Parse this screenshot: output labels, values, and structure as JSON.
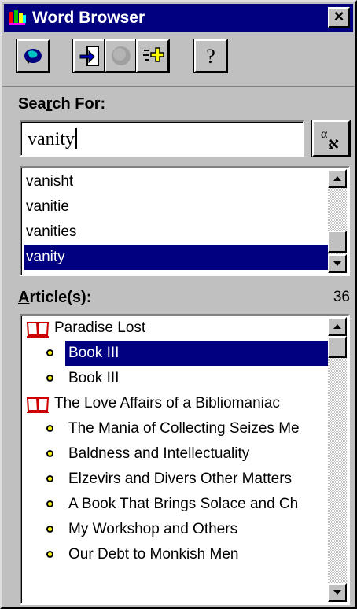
{
  "window": {
    "title": "Word Browser",
    "close_glyph": "×",
    "icons": [
      "app-icon",
      "close-icon"
    ]
  },
  "toolbar": {
    "buttons": [
      {
        "name": "globe-lookup-button",
        "icon": "globe-icon"
      },
      {
        "name": "go-back-button",
        "icon": "arrow-into-page-icon"
      },
      {
        "name": "stop-button",
        "icon": "gray-circle-icon"
      },
      {
        "name": "add-highlight-button",
        "icon": "star-plus-icon"
      },
      {
        "name": "help-button",
        "icon": "question-icon",
        "glyph": "?"
      }
    ]
  },
  "search": {
    "label_prefix": "Sea",
    "label_accel": "r",
    "label_suffix": "ch For:",
    "value": "vanity",
    "alpha_button_icon": "alpha-aleph-icon",
    "alpha_glyph_top": "α",
    "alpha_glyph_bottom": "א"
  },
  "word_list": {
    "items": [
      "vanisht",
      "vanitie",
      "vanities",
      "vanity"
    ],
    "selected_index": 3
  },
  "articles": {
    "label_accel": "A",
    "label_suffix": "rticle(s):",
    "count": "36",
    "items": [
      {
        "type": "book",
        "text": "Paradise Lost"
      },
      {
        "type": "chapter",
        "text": "Book III",
        "selected": true
      },
      {
        "type": "chapter",
        "text": "Book III"
      },
      {
        "type": "book",
        "text": "The Love Affairs of a Bibliomaniac"
      },
      {
        "type": "chapter",
        "text": "The Mania of Collecting Seizes Me"
      },
      {
        "type": "chapter",
        "text": "Baldness and Intellectuality"
      },
      {
        "type": "chapter",
        "text": "Elzevirs and Divers Other Matters"
      },
      {
        "type": "chapter",
        "text": "A Book That Brings Solace and Ch"
      },
      {
        "type": "chapter",
        "text": "My Workshop and Others"
      },
      {
        "type": "chapter",
        "text": "Our Debt to Monkish Men"
      }
    ]
  },
  "colors": {
    "face": "#c0c0c0",
    "title_bar": "#000080",
    "selection": "#000080",
    "bullet": "#ffff00",
    "book_icon": "#cc0000"
  }
}
